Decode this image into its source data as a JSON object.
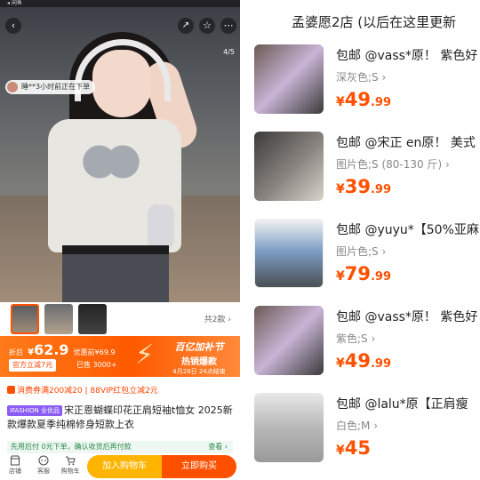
{
  "status_bar": {
    "carrier": "◂ 闲鱼"
  },
  "product": {
    "image_counter": "4/5",
    "buyer_notice": "睡**3小时前正在下单",
    "total_label": "共2款",
    "price_label": "折后",
    "price_yen": "¥",
    "price_value": "62.9",
    "price_tail": "优惠前¥69.9",
    "coupon": "官方立减7元",
    "sold": "已售 3000+",
    "festival_title": "百亿加补节",
    "festival_sub": "热销爆款",
    "festival_time": "4月28日 24点结束",
    "coupons_line": "消费券满200减20 | 88VIP红包立减2元",
    "brand_badge": "IFASHION 全优品",
    "title": "宋正恩蝴蝶印花正肩短袖t恤女 2025新款爆款夏季纯棉修身短款上衣",
    "notice_text": "先用后付 0元下单，确认收货后再付款",
    "notice_action": "查看 ›"
  },
  "bottom_bar": {
    "store": "店铺",
    "service": "客服",
    "cart": "购物车",
    "add_to_cart": "加入购物车",
    "buy_now": "立即购买"
  },
  "shop": {
    "title": "孟婆愿2店 (以后在这里更新"
  },
  "items": [
    {
      "title": "包邮 @vass*原！ 紫色好",
      "spec": "深灰色;S ›",
      "yen": "¥",
      "int": "49",
      "dec": ".99"
    },
    {
      "title": "包邮 @宋正 en原！ 美式",
      "spec": "图片色;S (80-130 斤) ›",
      "yen": "¥",
      "int": "39",
      "dec": ".99"
    },
    {
      "title": "包邮 @yuyu*【50%亚麻",
      "spec": "图片色;S ›",
      "yen": "¥",
      "int": "79",
      "dec": ".99"
    },
    {
      "title": "包邮 @vass*原！ 紫色好",
      "spec": "紫色;S ›",
      "yen": "¥",
      "int": "49",
      "dec": ".99"
    },
    {
      "title": "包邮 @lalu*原【正肩瘦",
      "spec": "白色;M ›",
      "yen": "¥",
      "int": "45",
      "dec": ""
    }
  ],
  "icons": {
    "back": "chevron-left-icon",
    "share": "share-icon",
    "favorite": "star-icon",
    "more": "more-icon"
  },
  "colors": {
    "accent": "#ff5000",
    "cart_button": "#ffb400"
  }
}
